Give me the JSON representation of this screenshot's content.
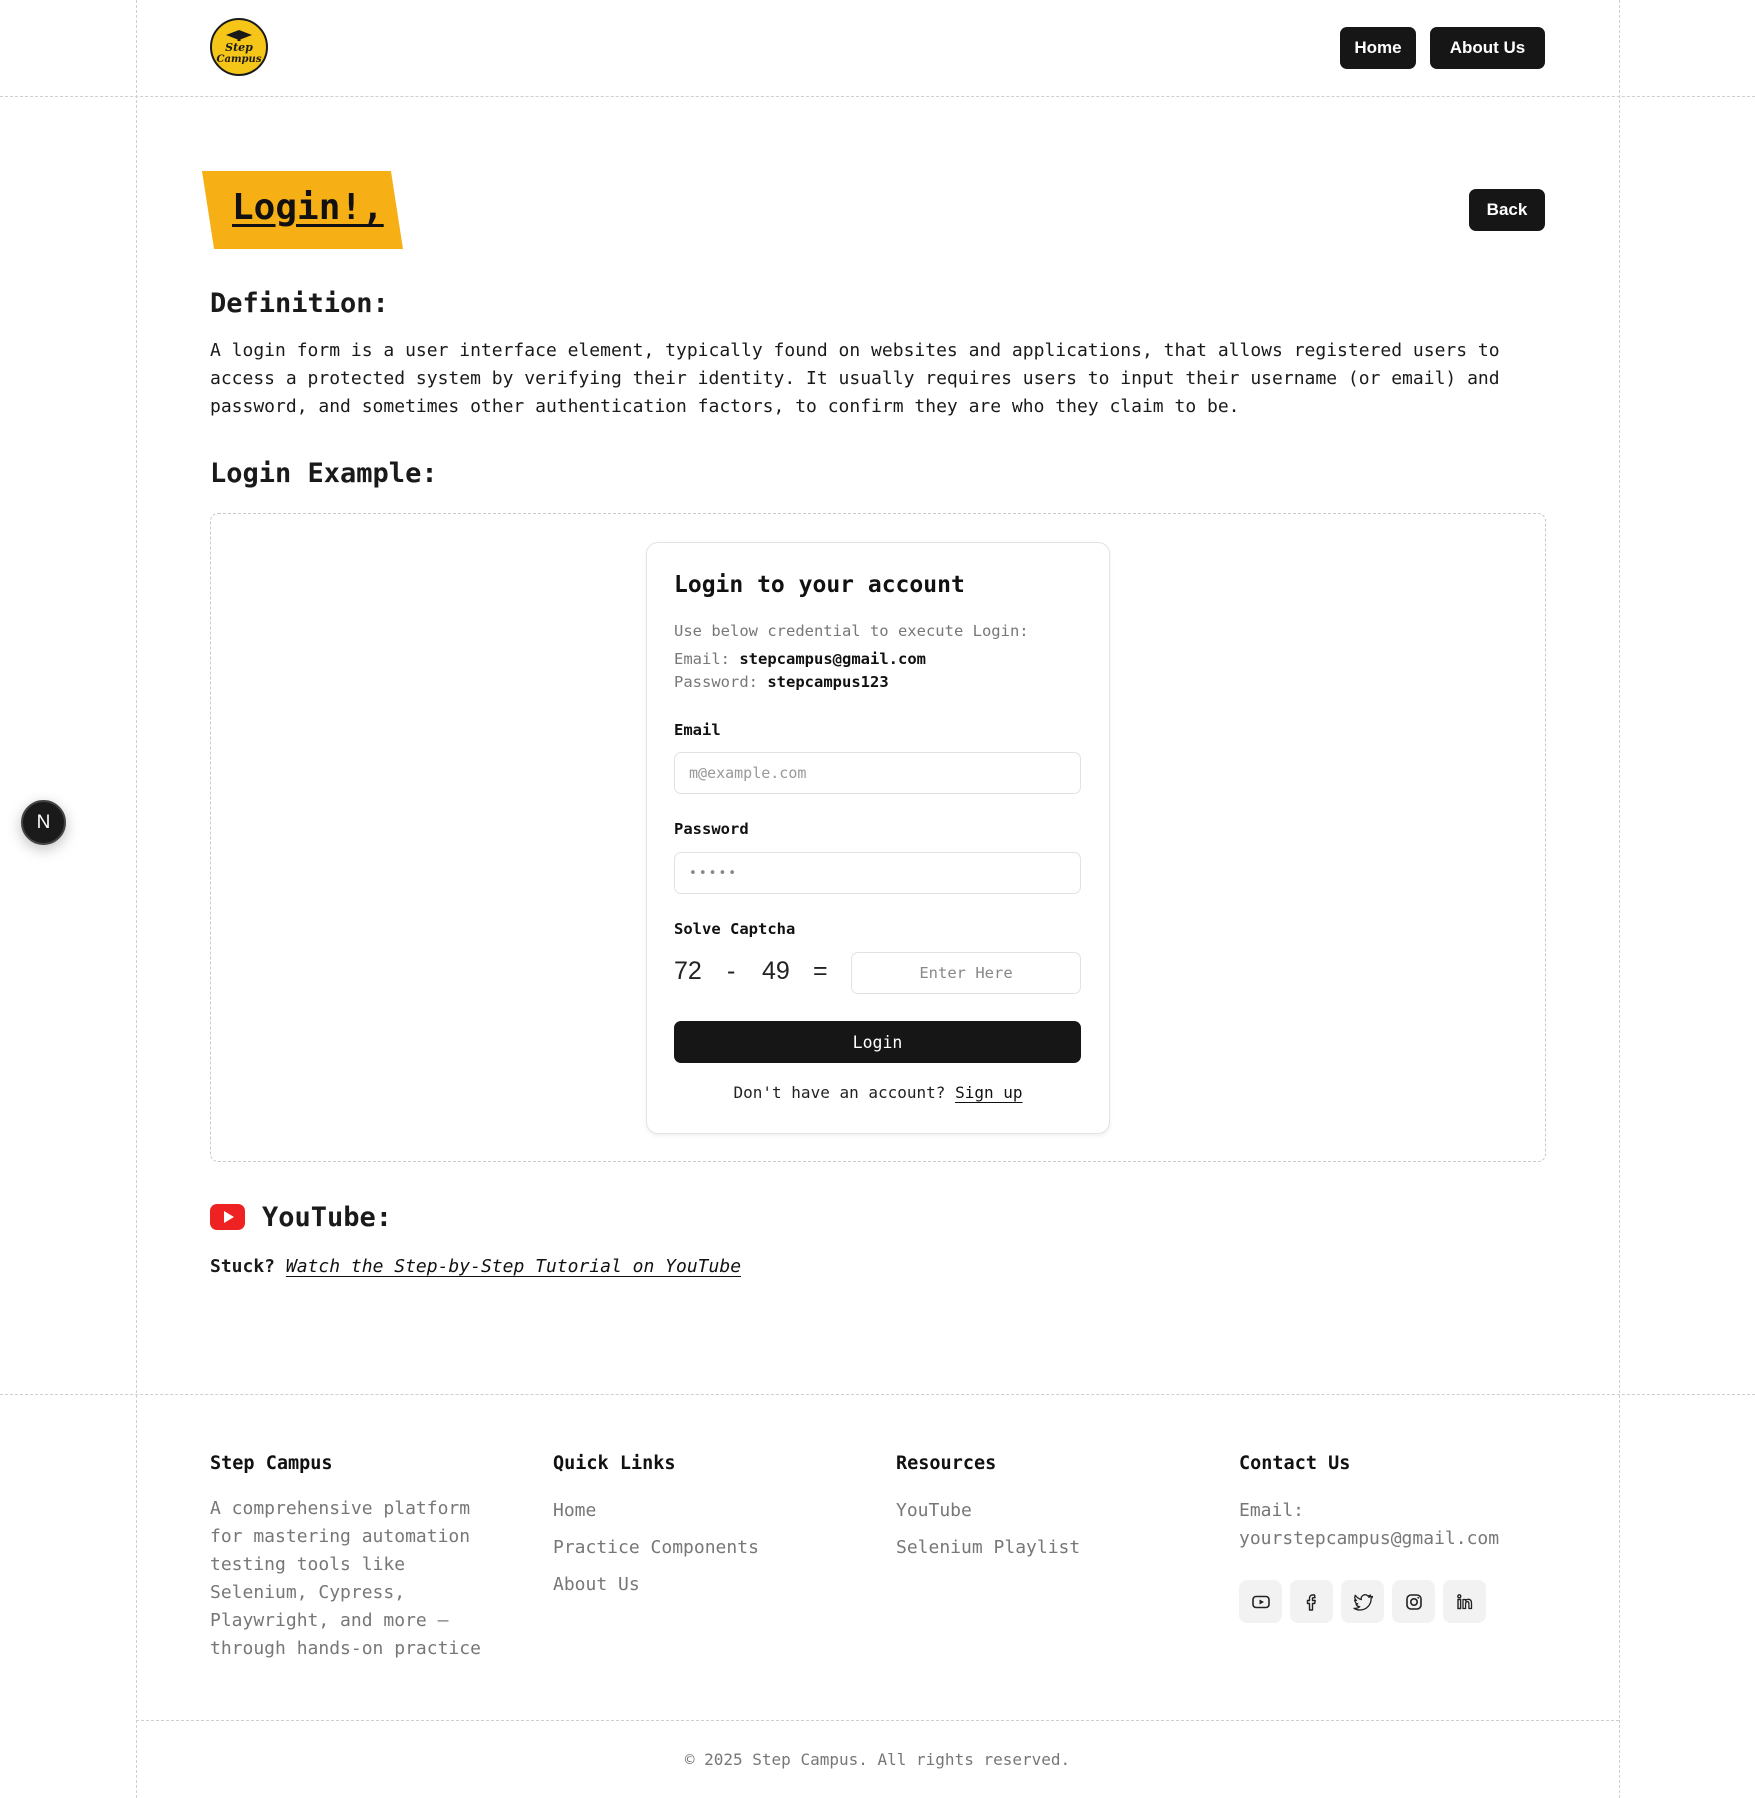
{
  "header": {
    "logo_text": "Step Campus",
    "nav": [
      {
        "label": "Home"
      },
      {
        "label": "About Us"
      }
    ]
  },
  "page": {
    "title": "Login!,",
    "back_label": "Back",
    "definition_heading": "Definition:",
    "definition_text": "A login form is a user interface element, typically found on websites and applications, that allows registered users to access a protected system by verifying their identity. It usually requires users to input their username (or email) and password, and sometimes other authentication factors, to confirm they are who they claim to be.",
    "example_heading": "Login Example:"
  },
  "login_card": {
    "title": "Login to your account",
    "instruction": "Use below credential to execute Login:",
    "email_prefix": "Email:",
    "email_value": "stepcampus@gmail.com",
    "password_prefix": "Password:",
    "password_value": "stepcampus123",
    "email_label": "Email",
    "email_placeholder": "m@example.com",
    "password_label": "Password",
    "password_mask": "•••••",
    "captcha_label": "Solve Captcha",
    "captcha_a": "72",
    "captcha_op": "-",
    "captcha_b": "49",
    "captcha_eq": "=",
    "captcha_placeholder": "Enter Here",
    "login_button": "Login",
    "signup_prompt": "Don't have an account?",
    "signup_link": "Sign up"
  },
  "floating_badge": "N",
  "youtube": {
    "heading": "YouTube:",
    "stuck_label": "Stuck?",
    "link_text": "Watch the Step-by-Step Tutorial on YouTube"
  },
  "footer": {
    "brand_heading": "Step Campus",
    "brand_description_lines": [
      "A comprehensive platform",
      "for mastering automation",
      "testing tools like",
      "Selenium, Cypress,",
      "Playwright, and more —",
      "through hands-on practice"
    ],
    "quick_links_heading": "Quick Links",
    "quick_links": [
      "Home",
      "Practice Components",
      "About Us"
    ],
    "resources_heading": "Resources",
    "resources": [
      "YouTube",
      "Selenium Playlist"
    ],
    "contact_heading": "Contact Us",
    "contact_email_label": "Email:",
    "contact_email": "yourstepcampus@gmail.com",
    "social_icons": [
      "youtube-icon",
      "facebook-icon",
      "twitter-icon",
      "instagram-icon",
      "linkedin-icon"
    ],
    "copyright": "© 2025 Step Campus. All rights reserved."
  },
  "colors": {
    "banner": "#f6b015",
    "button_dark": "#161616",
    "youtube_red": "#ee2222"
  }
}
